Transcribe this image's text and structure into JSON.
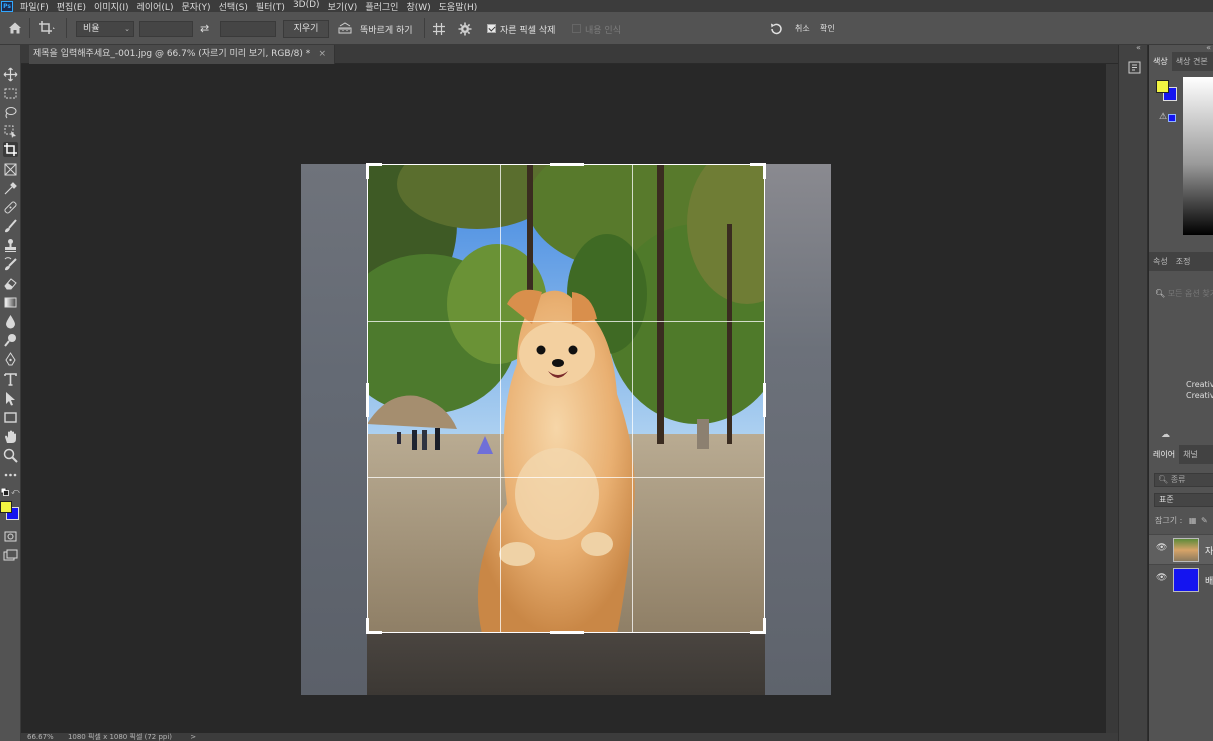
{
  "app": {
    "logo": "Ps"
  },
  "menu": [
    "파일(F)",
    "편집(E)",
    "이미지(I)",
    "레이어(L)",
    "문자(Y)",
    "선택(S)",
    "필터(T)",
    "3D(D)",
    "보기(V)",
    "플러그인",
    "창(W)",
    "도움말(H)"
  ],
  "options": {
    "ratio": "비율",
    "clear_label": "지우기",
    "straighten_label": "똑바르게 하기",
    "delete_pixels_label": "자른 픽셀 삭제",
    "delete_pixels_checked": true,
    "content_aware_label": "내용 인식",
    "content_aware_checked": false,
    "cancel_label": "취소",
    "commit_label": "확인"
  },
  "document": {
    "tab_title": "제목을 입력해주세요_-001.jpg @ 66.7% (자르기 미리 보기, RGB/8) *",
    "close": "×"
  },
  "status": {
    "zoom": "66.67%",
    "dimensions": "1080 픽셀 x 1080 픽셀 (72 ppi)",
    "arrow": ">"
  },
  "colors": {
    "foreground": "#f2f542",
    "background": "#1414f0"
  },
  "panels": {
    "color_tabs": [
      "색상",
      "색상 견본"
    ],
    "properties_tabs": [
      "속성",
      "조정"
    ],
    "properties_search_placeholder": "모든 옵션 찾기",
    "creative_line1": "Creative",
    "creative_line2": "Creative",
    "layers_tabs": [
      "레이어",
      "채널"
    ],
    "layer_filter": "종류",
    "blend_mode": "표준",
    "lock_label": "잠그기 :",
    "layers": [
      {
        "name": "자르기",
        "kind": "photo",
        "selected": true
      },
      {
        "name": "배경",
        "kind": "fill",
        "selected": false
      }
    ]
  }
}
